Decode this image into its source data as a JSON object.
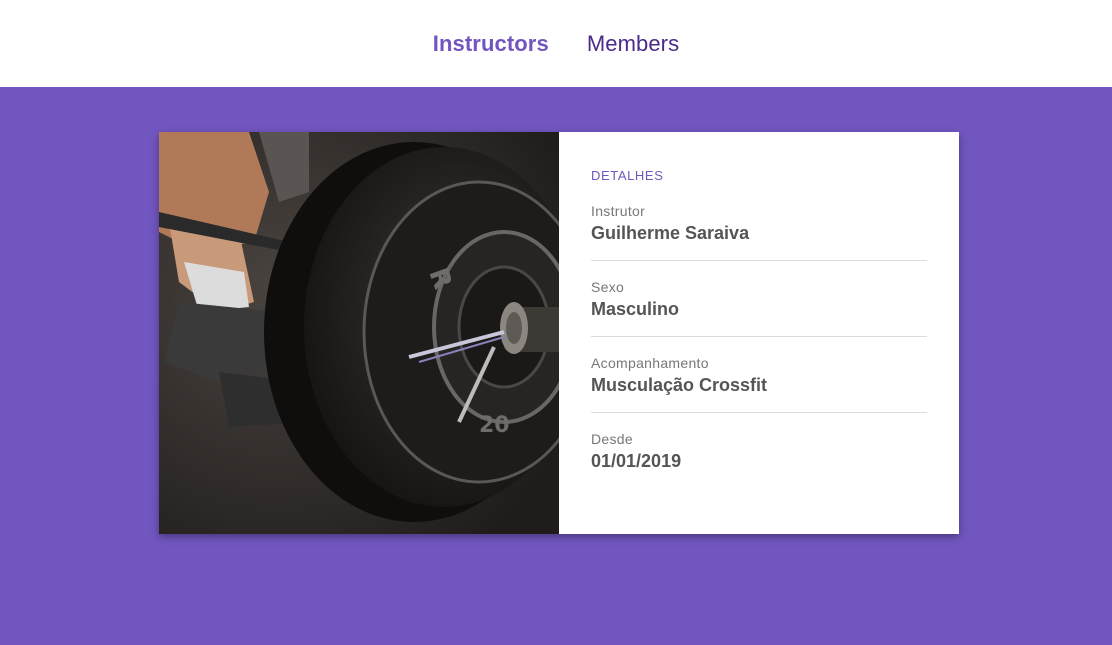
{
  "nav": {
    "items": [
      {
        "label": "Instructors",
        "active": true
      },
      {
        "label": "Members",
        "active": false
      }
    ]
  },
  "card": {
    "image": {
      "icon": "barbell-weight-plate-photo"
    },
    "heading": "DETALHES",
    "fields": [
      {
        "label": "Instrutor",
        "value": "Guilherme Saraiva"
      },
      {
        "label": "Sexo",
        "value": "Masculino"
      },
      {
        "label": "Acompanhamento",
        "value": "Musculação Crossfit"
      },
      {
        "label": "Desde",
        "value": "01/01/2019"
      }
    ]
  },
  "colors": {
    "accent": "#7156c0",
    "nav_text": "#4b2a8a",
    "card_bg": "#ffffff",
    "value_text": "#555555",
    "label_text": "#777777"
  }
}
